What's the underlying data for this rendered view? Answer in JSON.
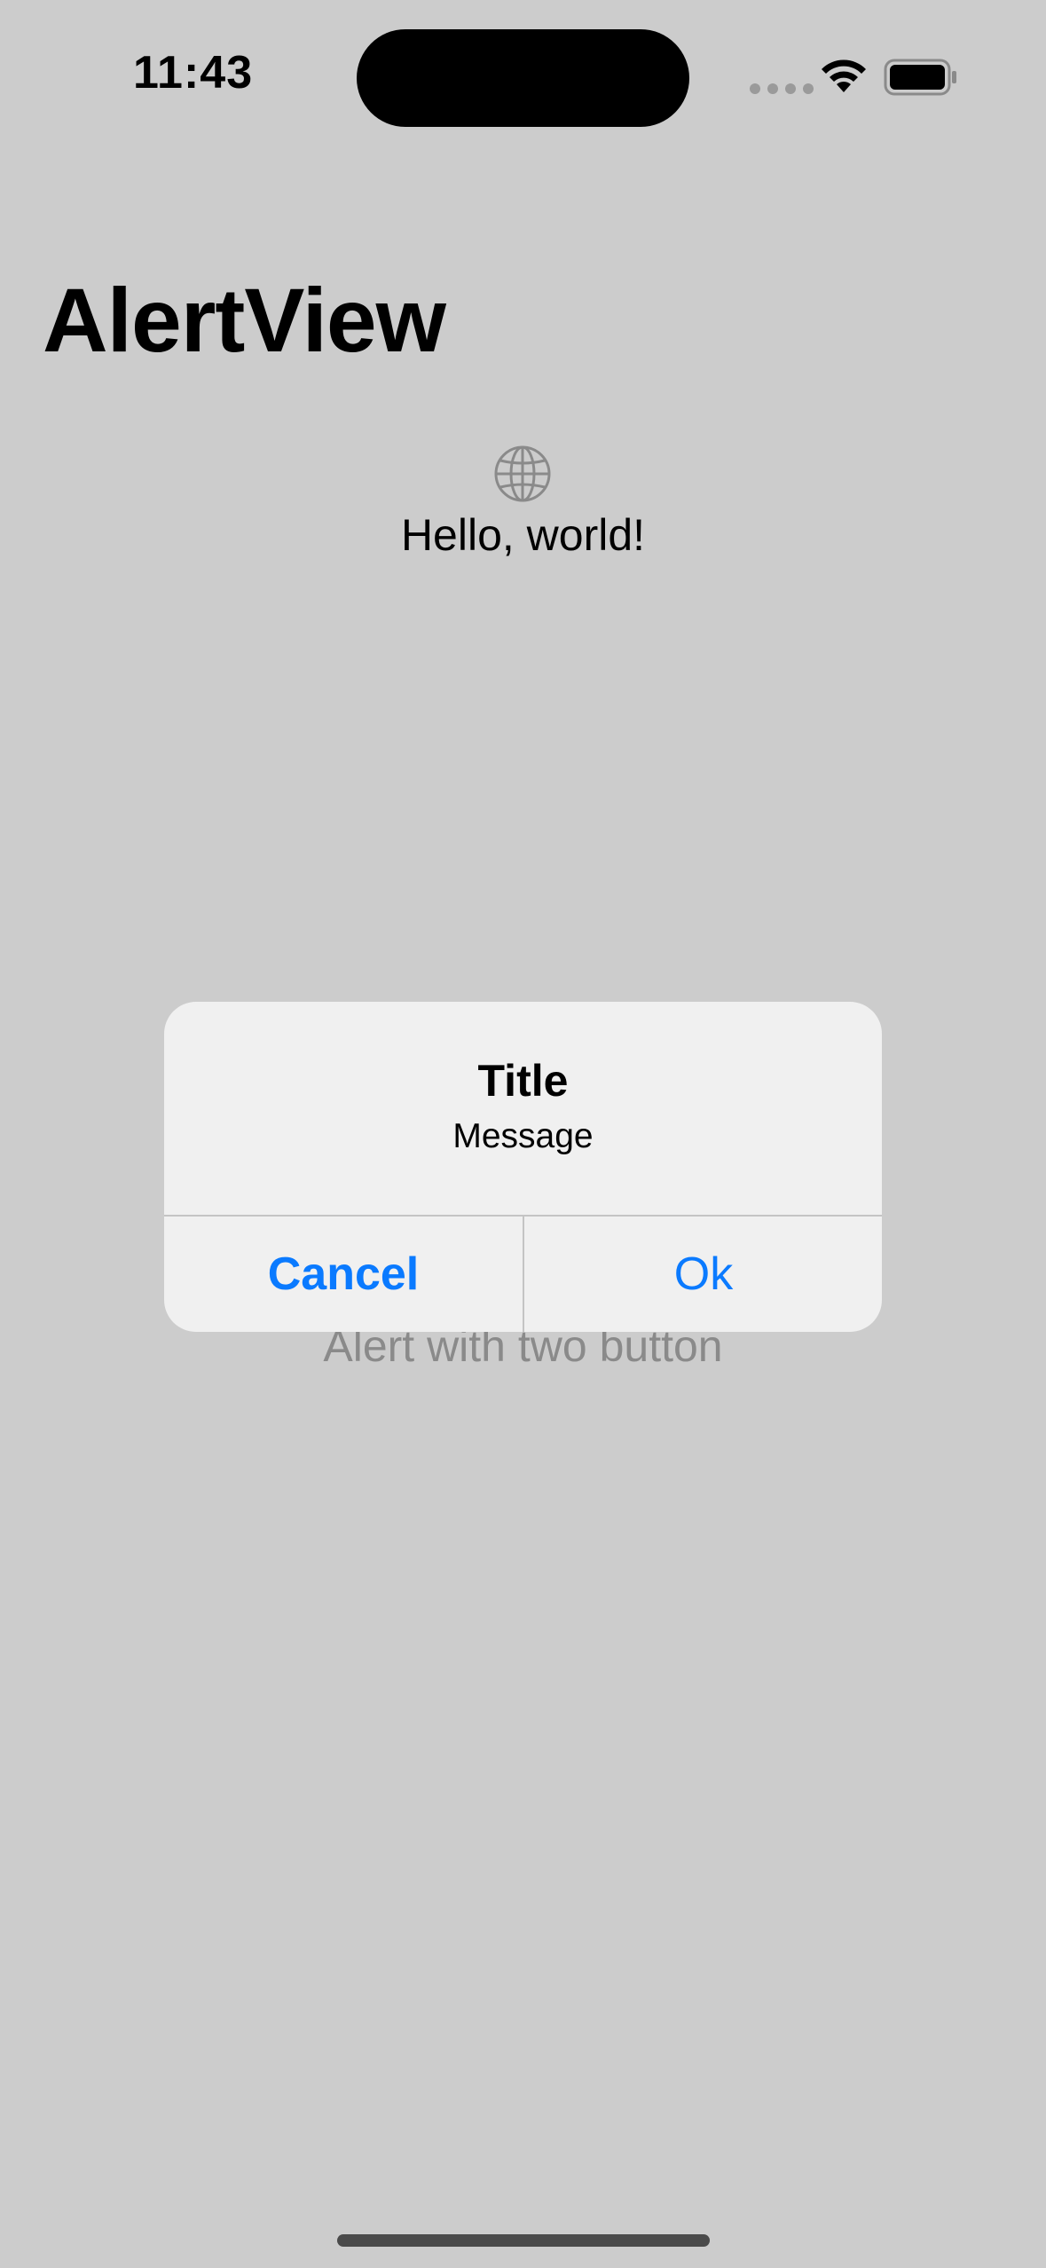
{
  "status_bar": {
    "time": "11:43",
    "icons": [
      "signal-dots-icon",
      "wifi-icon",
      "battery-icon"
    ]
  },
  "nav": {
    "title": "AlertView"
  },
  "content": {
    "icon": "globe-icon",
    "greeting": "Hello, world!",
    "button_label": "Alert with two button"
  },
  "alert": {
    "title": "Title",
    "message": "Message",
    "cancel_label": "Cancel",
    "ok_label": "Ok"
  },
  "colors": {
    "accent": "#0a7aff",
    "dimmed_background": "#cccccc",
    "alert_background": "#f0f0f0"
  }
}
